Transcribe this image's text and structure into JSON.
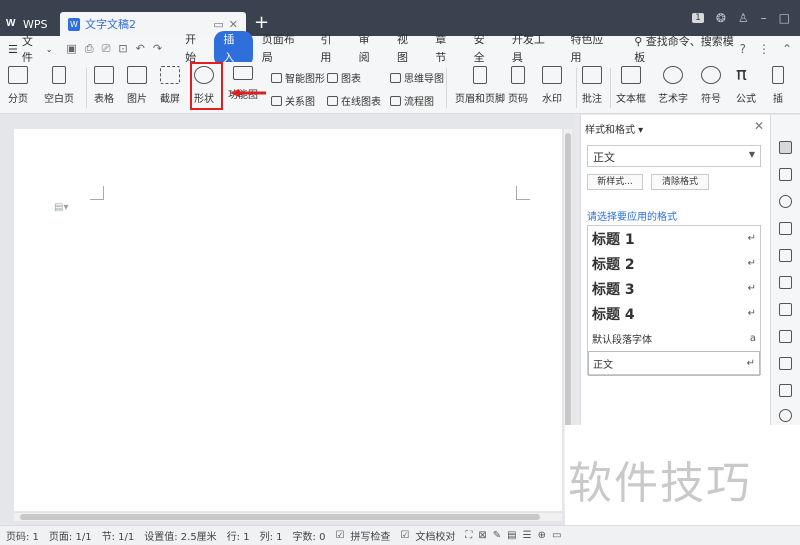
{
  "titlebar": {
    "app_label": "WPS",
    "doc_tab_title": "文字文稿2",
    "count_badge": "1"
  },
  "menubar": {
    "file_label": "文件",
    "tabs": [
      "开始",
      "插入",
      "页面布局",
      "引用",
      "审阅",
      "视图",
      "章节",
      "安全",
      "开发工具",
      "特色应用"
    ],
    "active_tab": "插入",
    "search_label": "查找命令、搜索模板"
  },
  "ribbon": {
    "fenye": "分页",
    "kongbaiye": "空白页",
    "biaoge": "表格",
    "tupian": "图片",
    "jieping": "截屏",
    "xingzhuang": "形状",
    "gongnengtu": "功能图",
    "zhinengtuxing": "智能图形",
    "guanxitu": "关系图",
    "tubiao": "图表",
    "zaixiantubiao": "在线图表",
    "siweidaotu": "思维导图",
    "liuchengtu": "流程图",
    "yemeiheyejiao": "页眉和页脚",
    "yema": "页码",
    "shuiyin": "水印",
    "pizhu": "批注",
    "wenbenkuang": "文本框",
    "yishuzi": "艺术字",
    "fuhao": "符号",
    "gongshi": "公式",
    "cha": "插"
  },
  "panel": {
    "title": "样式和格式",
    "current_style": "正文",
    "new_style_btn": "新样式...",
    "clear_format_btn": "清除格式",
    "hint": "请选择要应用的格式",
    "styles": [
      "标题 1",
      "标题 2",
      "标题 3",
      "标题 4",
      "默认段落字体",
      "正文"
    ],
    "markers": [
      "↵",
      "↵",
      "↵",
      "↵",
      "a",
      "↵"
    ]
  },
  "watermark": "软件技巧",
  "statusbar": {
    "page_code": "页码: 1",
    "page": "页面: 1/1",
    "section": "节: 1/1",
    "setting": "设置值: 2.5厘米",
    "row": "行: 1",
    "col": "列: 1",
    "words": "字数: 0",
    "spell": "拼写检查",
    "proof": "文档校对"
  }
}
